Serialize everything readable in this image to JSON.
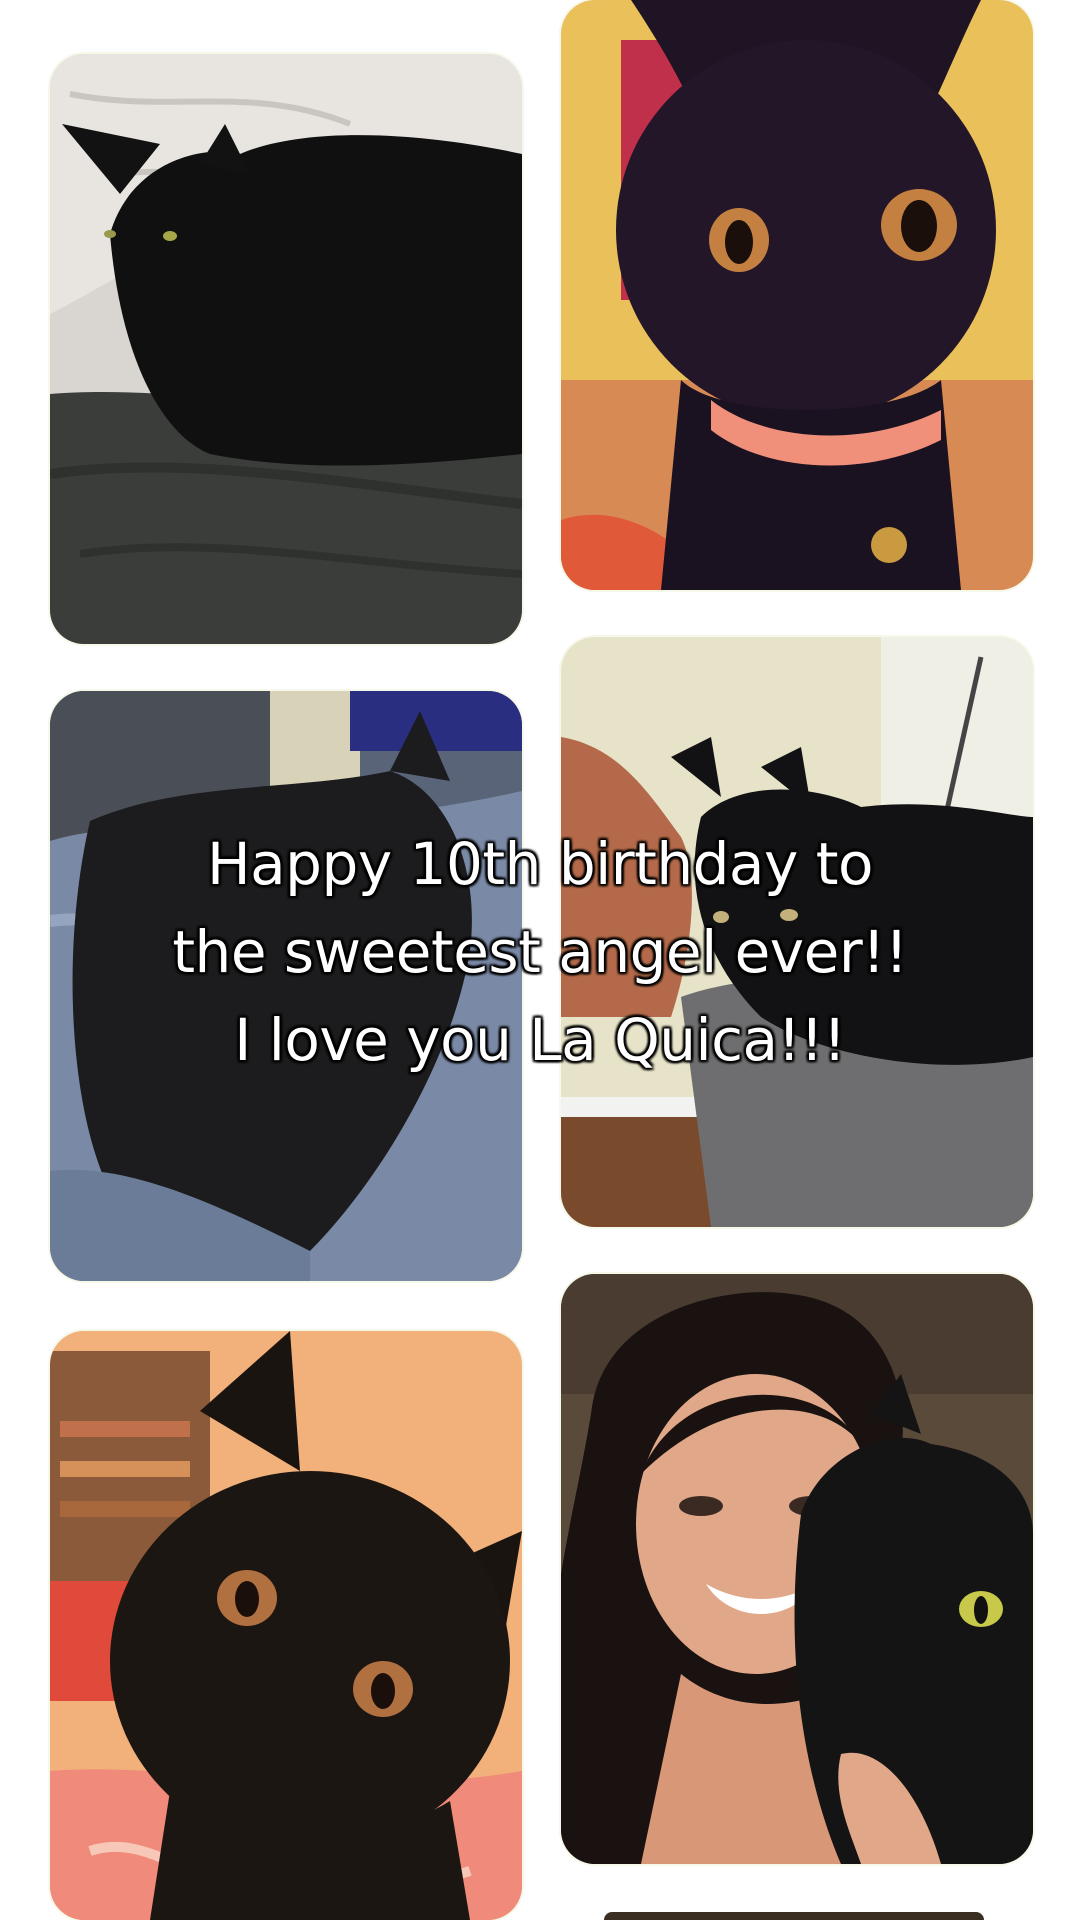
{
  "caption": {
    "line1": "Happy 10th birthday to",
    "line2": "the sweetest angel ever!!",
    "line3": "I love you La Quica!!!"
  },
  "photos": [
    {
      "subject": "black cat resting on a pillow"
    },
    {
      "subject": "black kitten close-up with pink collar and bell"
    },
    {
      "subject": "black cat lying on blue blanket"
    },
    {
      "subject": "black cat on a gray chair"
    },
    {
      "subject": "black kitten close-up"
    },
    {
      "subject": "smiling woman holding black cat"
    }
  ],
  "colors": {
    "background": "#ffffff",
    "caption_text": "#ffffff",
    "caption_outline": "#000000"
  }
}
